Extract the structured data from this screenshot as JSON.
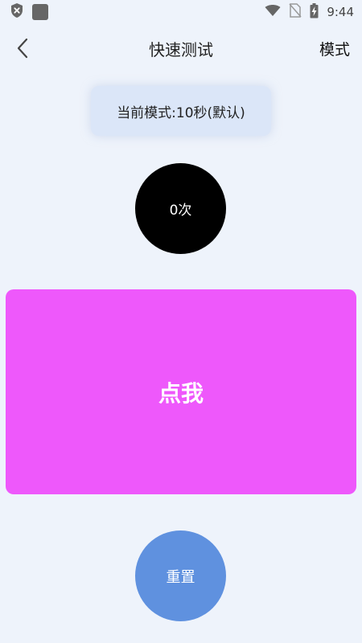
{
  "status_bar": {
    "time": "9:44",
    "left_icons": [
      "shield-x-icon",
      "app-square-icon"
    ],
    "right_icons": [
      "wifi-icon",
      "no-sim-icon",
      "battery-charging-icon"
    ]
  },
  "header": {
    "back_icon": "chevron-left-icon",
    "title": "快速测试",
    "mode_label": "模式"
  },
  "mode_pill": {
    "text": "当前模式:10秒(默认)"
  },
  "counter": {
    "text": "0次"
  },
  "tap_area": {
    "label": "点我"
  },
  "reset_button": {
    "label": "重置"
  },
  "colors": {
    "background": "#eef3fb",
    "mode_pill_bg": "#dbe6f8",
    "counter_bg": "#000000",
    "tap_area_bg": "#ee58fb",
    "reset_bg": "#5f91df"
  }
}
